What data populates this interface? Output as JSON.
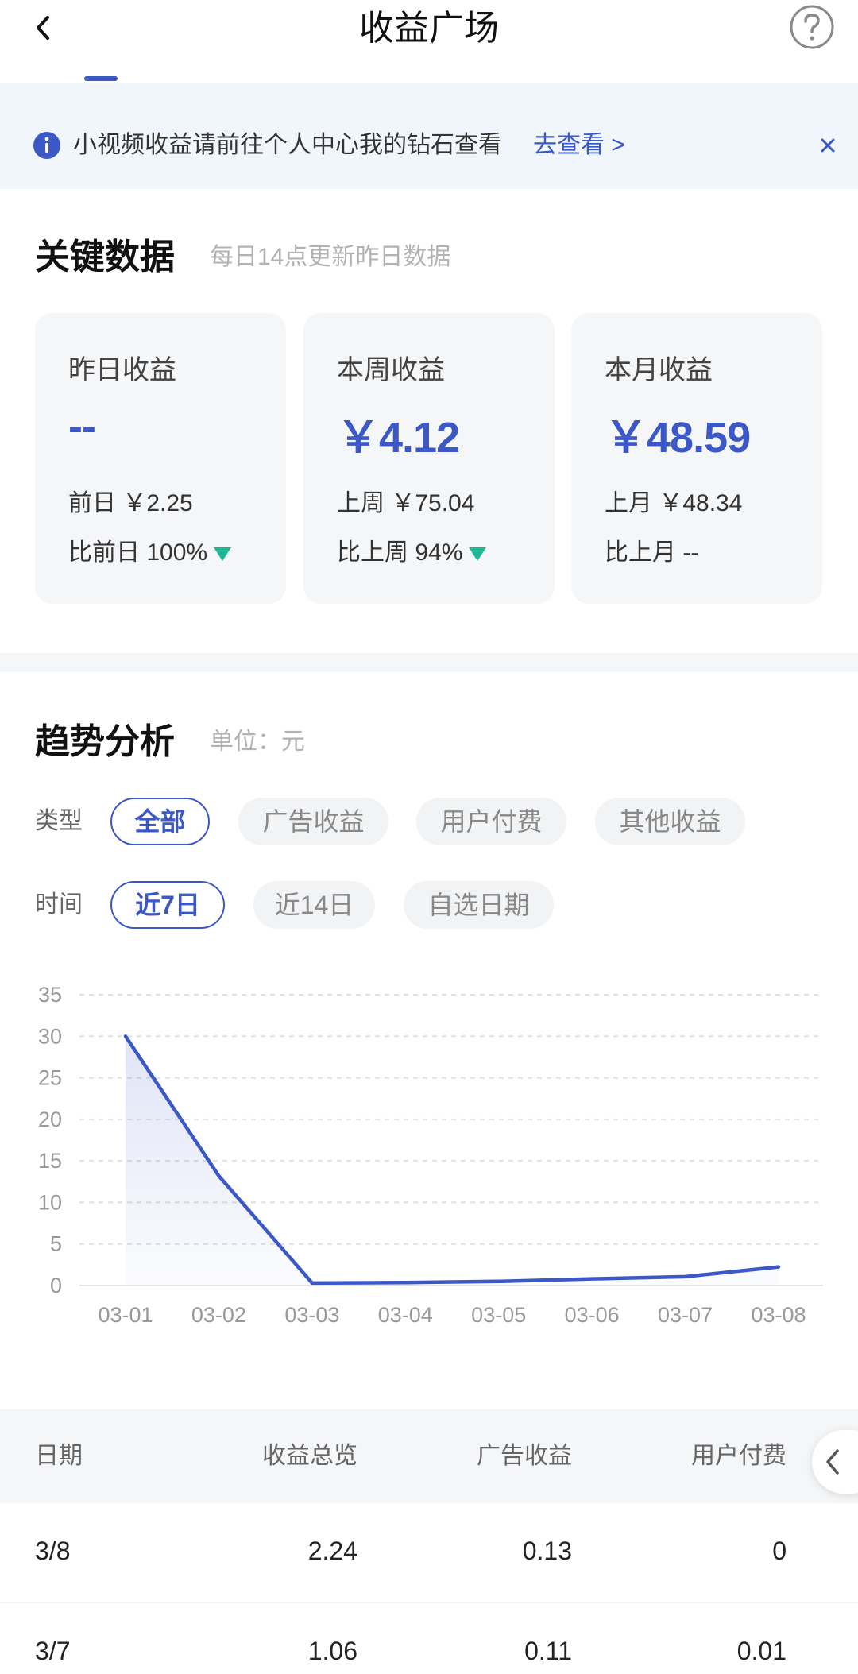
{
  "header": {
    "title": "收益广场"
  },
  "notice": {
    "text": "小视频收益请前往个人中心我的钻石查看",
    "link": "去查看 >"
  },
  "key_data": {
    "title": "关键数据",
    "subtitle": "每日14点更新昨日数据",
    "cards": [
      {
        "label": "昨日收益",
        "value": "--",
        "prev": "前日 ￥2.25",
        "cmp_label": "比前日",
        "cmp_value": "100%"
      },
      {
        "label": "本周收益",
        "value": "￥4.12",
        "prev": "上周 ￥75.04",
        "cmp_label": "比上周",
        "cmp_value": "94%"
      },
      {
        "label": "本月收益",
        "value": "￥48.59",
        "prev": "上月 ￥48.34",
        "cmp_label": "比上月",
        "cmp_value": "--"
      }
    ]
  },
  "trend": {
    "title": "趋势分析",
    "unit": "单位：元",
    "type_label": "类型",
    "type_chips": [
      "全部",
      "广告收益",
      "用户付费",
      "其他收益"
    ],
    "time_label": "时间",
    "time_chips": [
      "近7日",
      "近14日",
      "自选日期"
    ]
  },
  "chart_data": {
    "type": "line",
    "x": [
      "03-01",
      "03-02",
      "03-03",
      "03-04",
      "03-05",
      "03-06",
      "03-07",
      "03-08"
    ],
    "series": [
      {
        "values": [
          30,
          13.2,
          0.3,
          0.35,
          0.5,
          0.8,
          1.06,
          2.24
        ]
      }
    ],
    "ylim": [
      0,
      35
    ],
    "yticks": [
      0,
      5,
      10,
      15,
      20,
      25,
      30,
      35
    ],
    "grid": true,
    "color": "#3b58c6"
  },
  "table": {
    "headers": [
      "日期",
      "收益总览",
      "广告收益",
      "用户付费"
    ],
    "rows": [
      [
        "3/8",
        "2.24",
        "0.13",
        "0"
      ],
      [
        "3/7",
        "1.06",
        "0.11",
        "0.01"
      ]
    ]
  }
}
